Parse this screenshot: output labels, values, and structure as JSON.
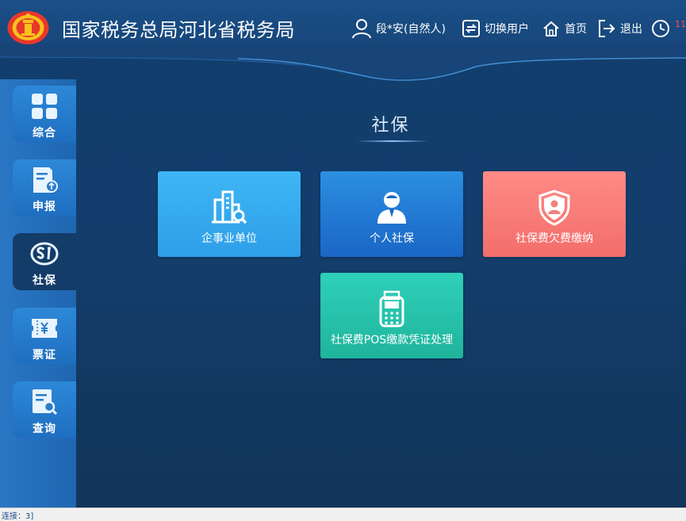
{
  "header": {
    "title": "国家税务总局河北省税务局",
    "user_label": "段*安(自然人)",
    "switch_label": "切换用户",
    "home_label": "首页",
    "logout_label": "退出",
    "clock_count": "11"
  },
  "sidebar": {
    "items": [
      {
        "label": "综合",
        "icon": "grid-icon"
      },
      {
        "label": "申报",
        "icon": "document-upload-icon"
      },
      {
        "label": "社保",
        "icon": "social-security-icon"
      },
      {
        "label": "票证",
        "icon": "ticket-icon"
      },
      {
        "label": "查询",
        "icon": "search-document-icon"
      }
    ],
    "active": "社保"
  },
  "main": {
    "section_title": "社保",
    "cards": [
      {
        "label": "企事业单位",
        "icon": "building-search-icon",
        "color": "#3fb6f5"
      },
      {
        "label": "个人社保",
        "icon": "person-icon",
        "color": "#1a66c6"
      },
      {
        "label": "社保费欠费缴纳",
        "icon": "shield-user-icon",
        "color": "#f26e6b"
      },
      {
        "label": "社保费POS缴款凭证处理",
        "icon": "pos-terminal-icon",
        "color": "#1fb49c"
      }
    ]
  },
  "statusbar": {
    "text": "连接：3]"
  }
}
